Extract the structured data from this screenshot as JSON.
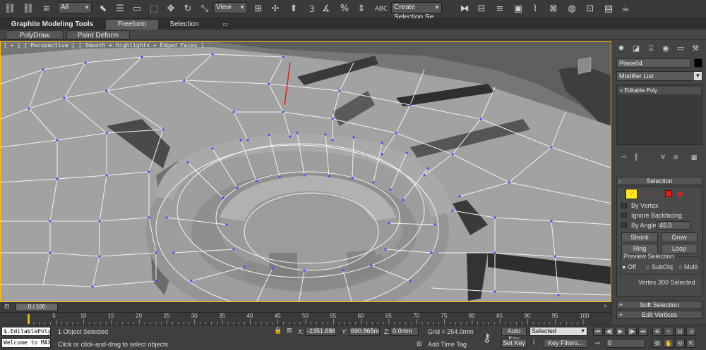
{
  "toolbar": {
    "selection_filter": "All",
    "ref_coord_system": "View",
    "named_selection": "Create Selection Se",
    "snap_angle": "3"
  },
  "ribbon": {
    "tabs": [
      "Graphite Modeling Tools",
      "Freeform",
      "Selection"
    ],
    "active_tab": "Freeform",
    "subtabs": [
      "PolyDraw",
      "Paint Deform"
    ]
  },
  "viewport": {
    "label": "[ + ] [ Perspective ] [ Smooth + Highlights + Edged Faces ]"
  },
  "command_panel": {
    "object_name": "Plane04",
    "modifier_list": "Modifier List",
    "stack_item": "Editable Poly",
    "selection_rollout": {
      "title": "Selection",
      "by_vertex": "By Vertex",
      "ignore_backfacing": "Ignore Backfacing",
      "by_angle": "By Angle:",
      "angle_value": "45.0",
      "shrink": "Shrink",
      "grow": "Grow",
      "ring": "Ring",
      "loop": "Loop",
      "preview_title": "Preview Selection",
      "preview_options": [
        "Off",
        "SubObj",
        "Multi"
      ],
      "status": "Vertex 300 Selected"
    },
    "soft_selection": "Soft Selection",
    "edit_vertices": "Edit Vertices"
  },
  "timeline": {
    "frame": "0 / 100",
    "ticks": [
      "0",
      "5",
      "10",
      "15",
      "20",
      "25",
      "30",
      "35",
      "40",
      "45",
      "50",
      "55",
      "60",
      "65",
      "70",
      "75",
      "80",
      "85",
      "90",
      "95",
      "100"
    ]
  },
  "status": {
    "maxscript_line1": "$.EditablePoly.",
    "maxscript_line2": "Welcome to MAX!",
    "objects_selected": "1 Object Selected",
    "prompt": "Click or click-and-drag to select objects",
    "x_label": "X:",
    "x_value": "-2351.686d",
    "y_label": "Y:",
    "y_value": "690.865mm",
    "z_label": "Z:",
    "z_value": "0.0mm",
    "grid": "Grid = 254.0mm",
    "add_time_tag": "Add Time Tag",
    "auto_key": "Auto Key",
    "set_key": "Set Key",
    "key_mode": "Selected",
    "key_filters": "Key Filters...",
    "current_frame": "0"
  },
  "colors": {
    "viewport_bg": "#787878",
    "mesh_face": "#a3a3a3",
    "active_border": "#ffc000",
    "vertex": "#4040ff"
  }
}
